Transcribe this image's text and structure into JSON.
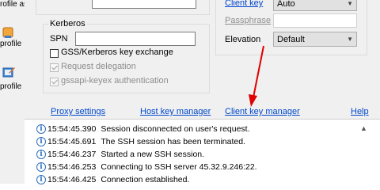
{
  "left_bar": {
    "items": [
      {
        "label": "rofile as"
      },
      {
        "label": "profile"
      },
      {
        "label": "profile"
      }
    ]
  },
  "upper_field": {
    "value": ""
  },
  "client_key": {
    "link": "Client key",
    "value": "Auto"
  },
  "passphrase": {
    "link": "Passphrase",
    "value": ""
  },
  "elevation": {
    "label": "Elevation",
    "value": "Default"
  },
  "kerberos": {
    "title": "Kerberos",
    "spn_label": "SPN",
    "spn_value": "",
    "gss_label": "GSS/Kerberos key exchange",
    "delegation_label": "Request delegation",
    "gssapi_label": "gssapi-keyex authentication"
  },
  "links": {
    "proxy": "Proxy settings",
    "host_key_manager": "Host key manager",
    "client_key_manager": "Client key manager",
    "help": "Help"
  },
  "colors": {
    "annotation_arrow": "#e00000",
    "link": "#0047cc",
    "info_icon": "#2c6fbf"
  },
  "log": [
    {
      "time": "15:54:45.390",
      "message": "Session disconnected on user's request."
    },
    {
      "time": "15:54:45.691",
      "message": "The SSH session has been terminated."
    },
    {
      "time": "15:54:46.237",
      "message": "Started a new SSH session."
    },
    {
      "time": "15:54:46.253",
      "message": "Connecting to SSH server 45.32.9.246:22."
    },
    {
      "time": "15:54:46.425",
      "message": "Connection established."
    }
  ]
}
